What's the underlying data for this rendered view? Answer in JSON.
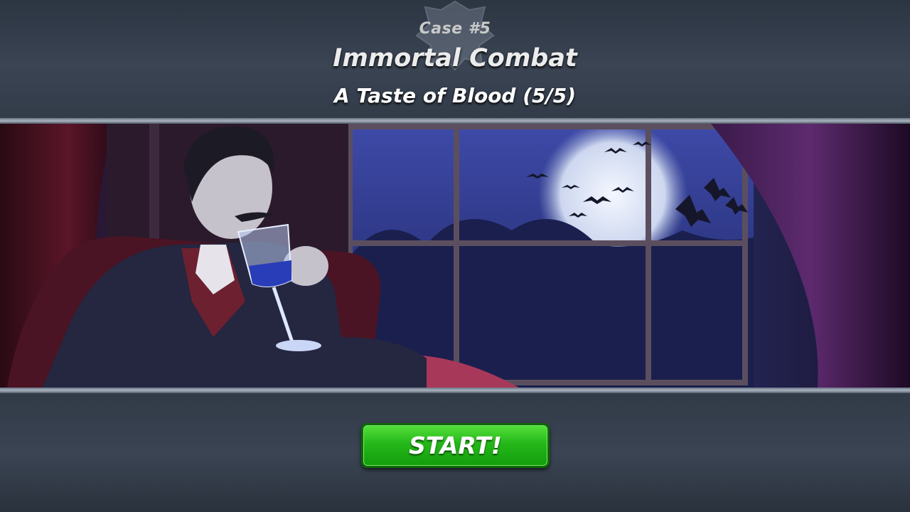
{
  "header": {
    "case_number": "Case #5",
    "case_title": "Immortal Combat",
    "chapter_title": "A Taste of Blood (5/5)"
  },
  "scene": {
    "description_icon": "vampire-scene",
    "subjects": [
      "vampire-character",
      "wine-glass",
      "window",
      "full-moon",
      "bats",
      "curtains",
      "armchair"
    ]
  },
  "actions": {
    "start_label": "START!"
  },
  "colors": {
    "accent_green": "#25b81a",
    "background": "#2f3845",
    "moon": "#dfe6f4"
  }
}
